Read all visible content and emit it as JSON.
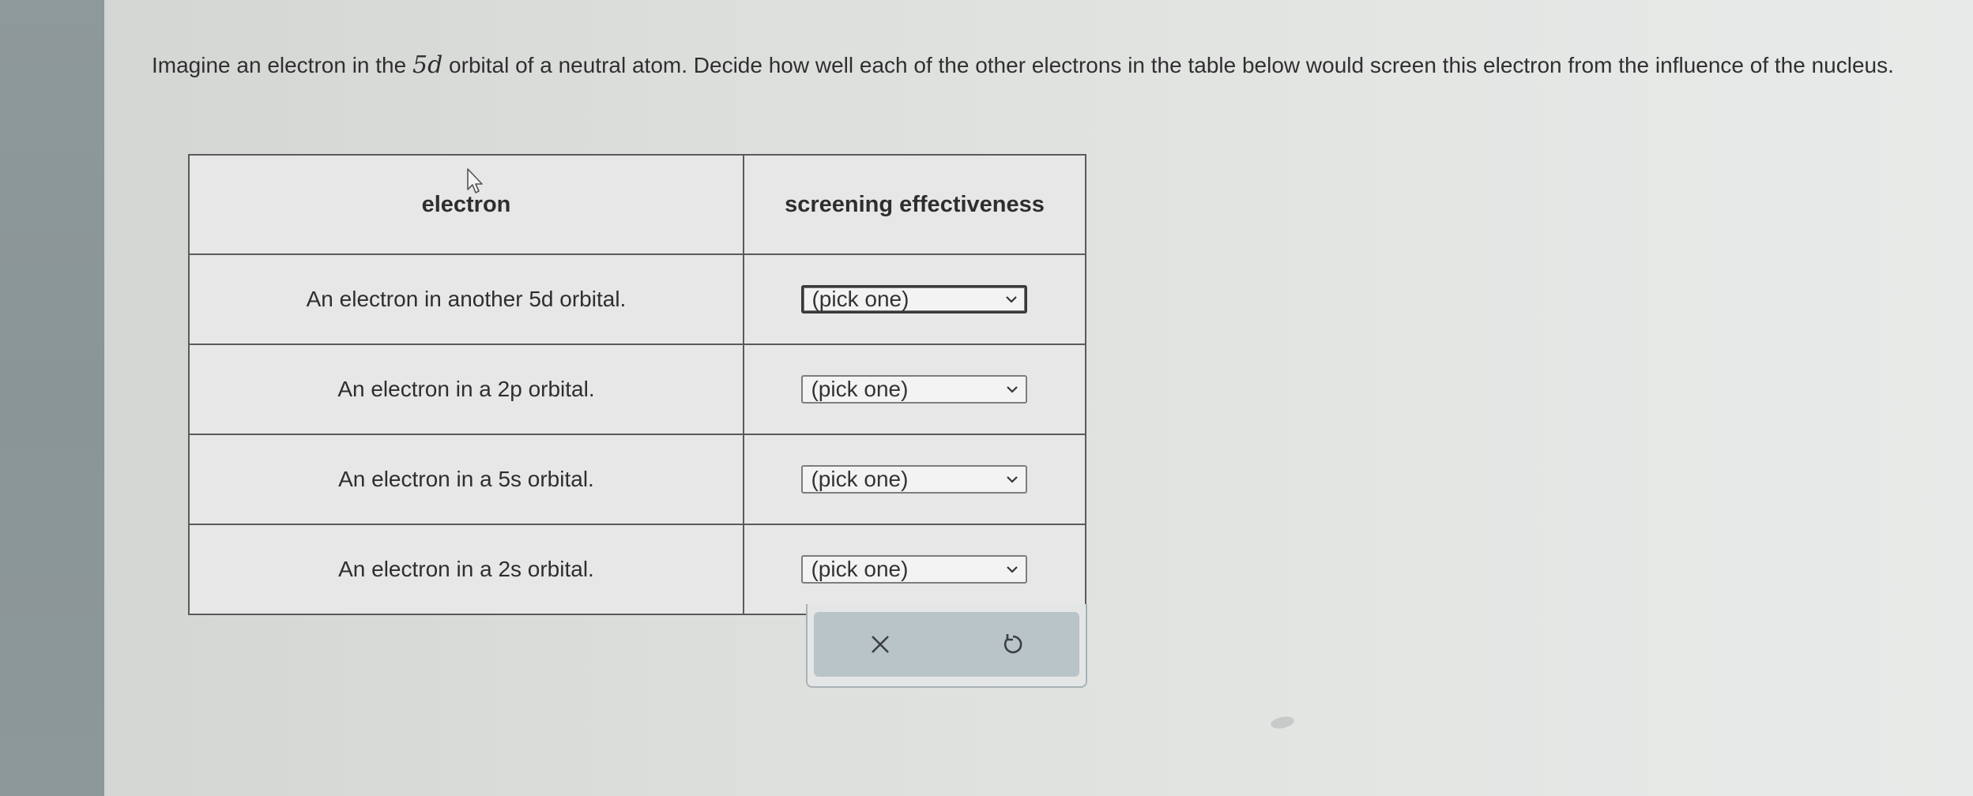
{
  "question": {
    "text_before": "Imagine an electron in the ",
    "orbital_math": "5d",
    "text_after": " orbital of a neutral atom. Decide how well each of the other electrons in the table below would screen this electron from the influence of the nucleus."
  },
  "table": {
    "headers": {
      "electron": "electron",
      "screening": "screening effectiveness"
    },
    "rows": [
      {
        "electron": "An electron in another 5d orbital.",
        "selection": "(pick one)"
      },
      {
        "electron": "An electron in a 2p orbital.",
        "selection": "(pick one)"
      },
      {
        "electron": "An electron in a 5s orbital.",
        "selection": "(pick one)"
      },
      {
        "electron": "An electron in a 2s orbital.",
        "selection": "(pick one)"
      }
    ]
  },
  "toolbar": {
    "clear_icon": "close-icon",
    "undo_icon": "undo-icon"
  },
  "colors": {
    "left_strip": "#8a9597",
    "toolbar_bg": "#b9c4c8",
    "table_border": "#5a5a5a"
  }
}
